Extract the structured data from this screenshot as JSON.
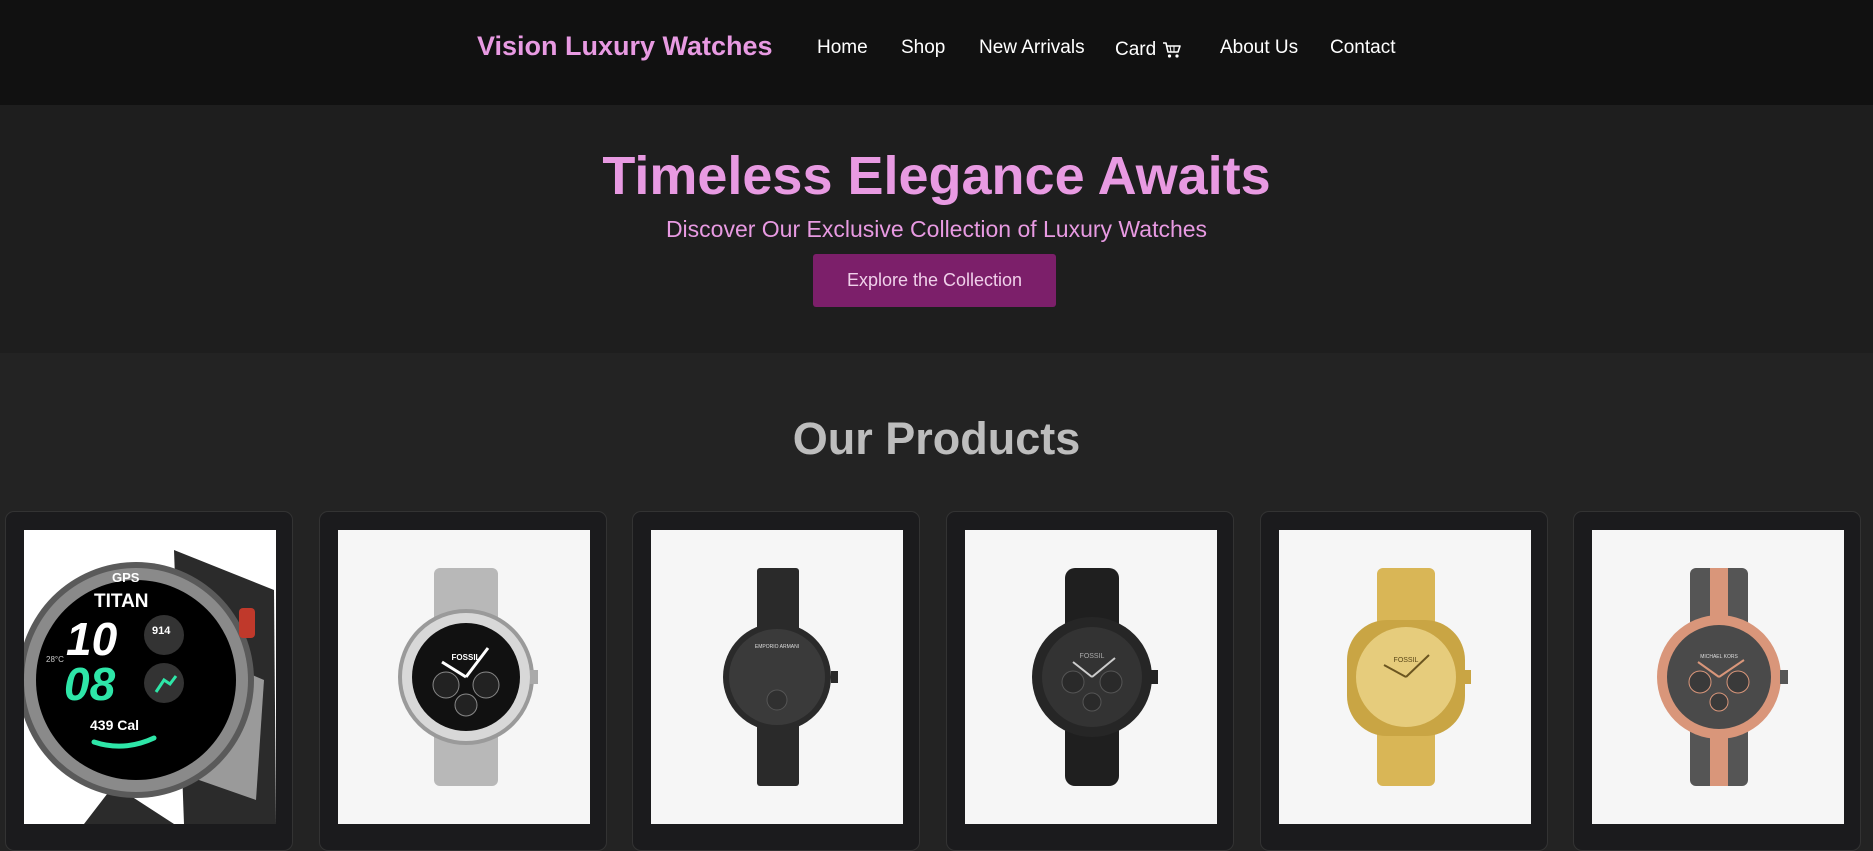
{
  "header": {
    "brand": "Vision Luxury Watches",
    "nav": [
      {
        "label": "Home"
      },
      {
        "label": "Shop"
      },
      {
        "label": "New Arrivals"
      },
      {
        "label": "Card"
      },
      {
        "label": "About Us"
      },
      {
        "label": "Contact"
      }
    ]
  },
  "hero": {
    "title": "Timeless Elegance Awaits",
    "subtitle": "Discover Our Exclusive Collection of Luxury Watches",
    "cta_label": "Explore the Collection"
  },
  "products": {
    "title": "Our Products",
    "items": [
      {
        "image": "titan-smartwatch",
        "brand_mark": "TITAN",
        "screen": {
          "gps": "GPS",
          "hour": "10",
          "minute": "08",
          "steps": "914",
          "calories": "439 Cal",
          "temp": "28°C"
        }
      },
      {
        "image": "fossil-silver-chronograph",
        "brand_mark": "FOSSIL"
      },
      {
        "image": "emporio-armani-black-watch",
        "brand_mark": "EMPORIO ARMANI"
      },
      {
        "image": "fossil-black-leather-chronograph",
        "brand_mark": "FOSSIL"
      },
      {
        "image": "fossil-gold-watch",
        "brand_mark": "FOSSIL"
      },
      {
        "image": "michael-kors-two-tone-chronograph",
        "brand_mark": "MICHAEL KORS"
      }
    ]
  },
  "colors": {
    "accent": "#e89ae2",
    "button": "#7c1f6a",
    "header_bg": "#111111",
    "hero_bg": "#1e1e1e",
    "page_bg": "#232323"
  }
}
